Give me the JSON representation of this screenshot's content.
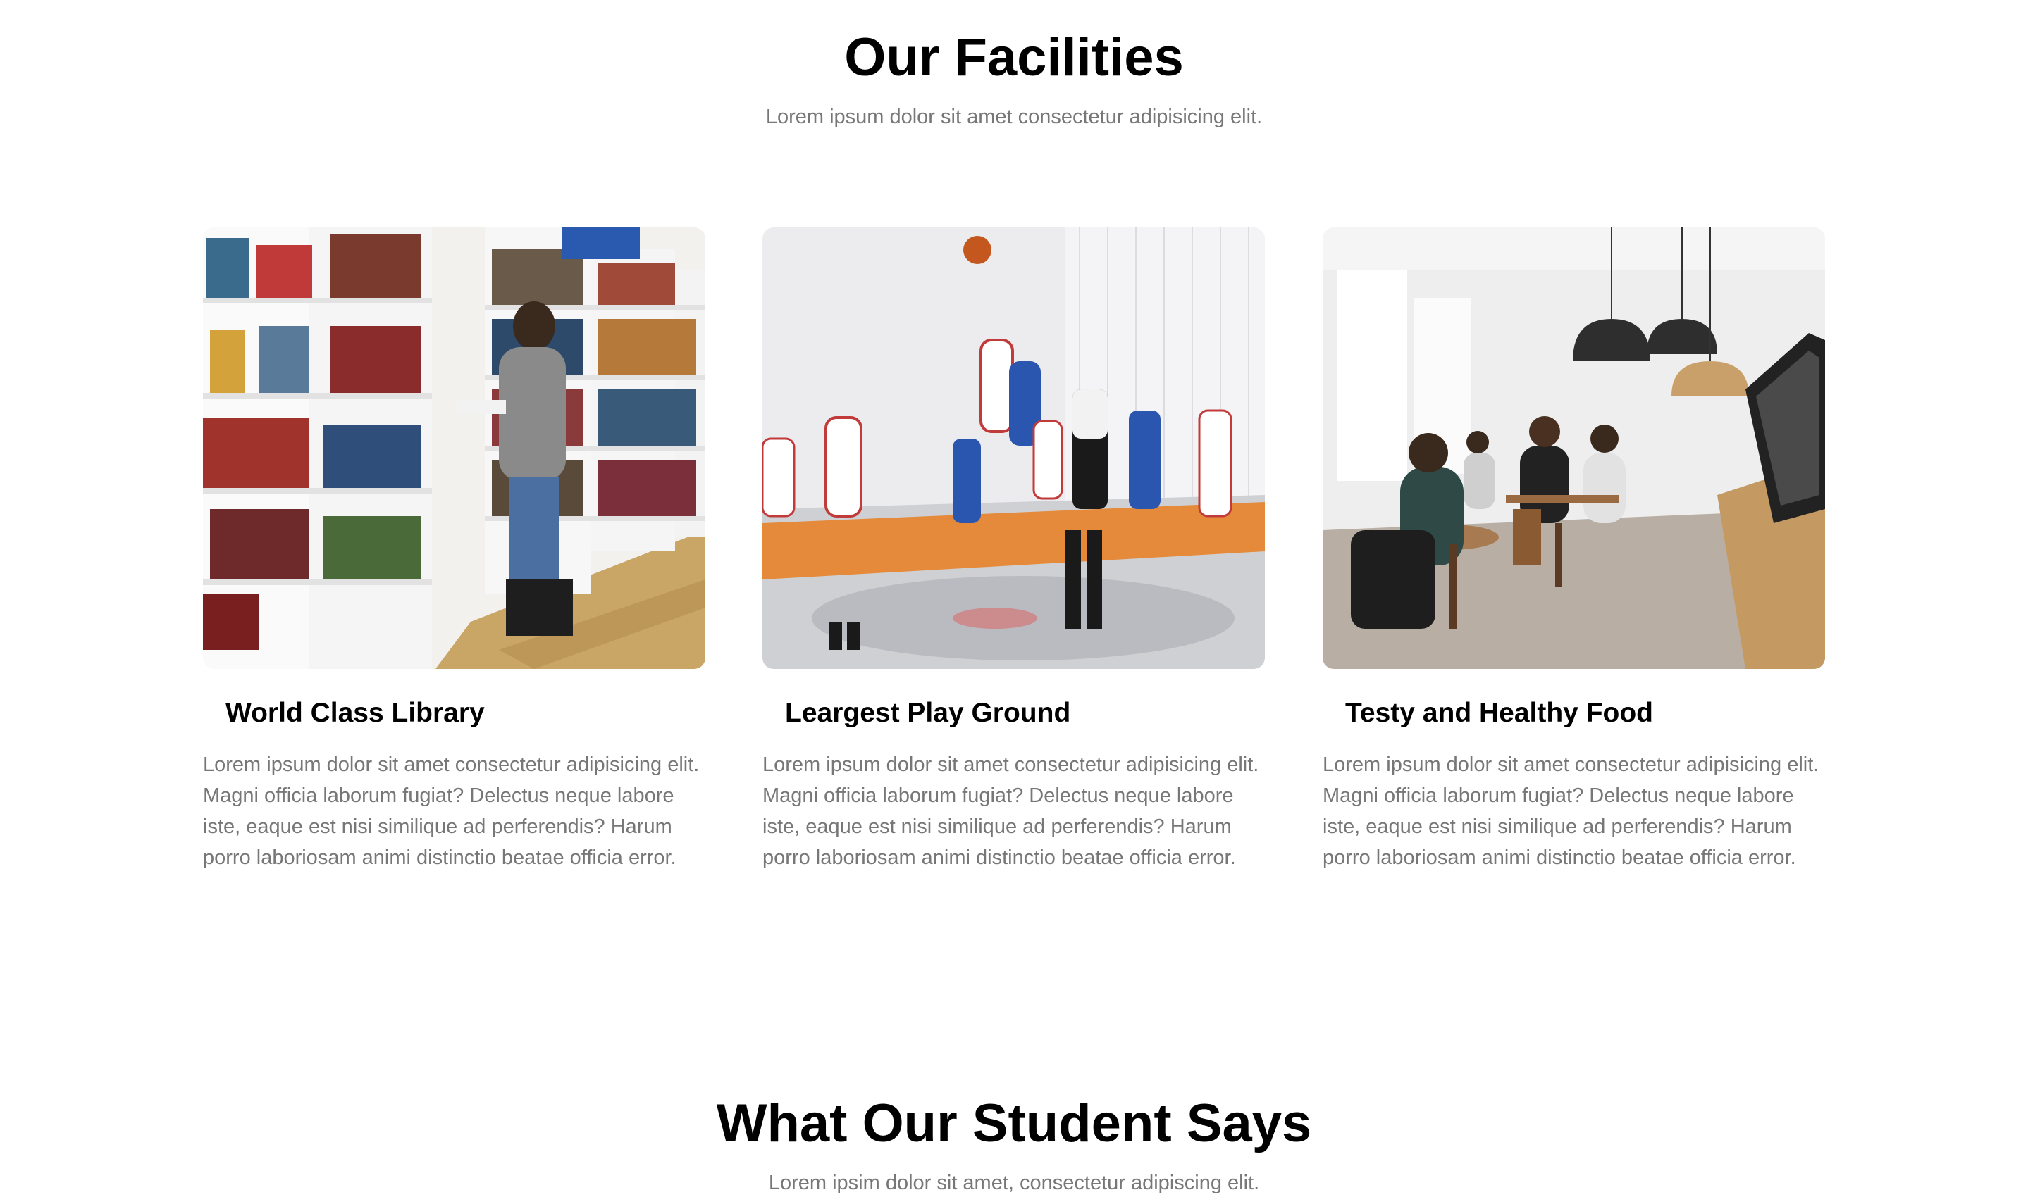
{
  "facilities": {
    "title": "Our Facilities",
    "subtitle": "Lorem ipsum dolor sit amet consectetur adipisicing elit.",
    "cards": [
      {
        "image": "library-photo",
        "title": "World Class Library",
        "text": "Lorem ipsum dolor sit amet consectetur adipisicing elit. Magni officia laborum fugiat? Delectus neque labore iste, eaque est nisi similique ad perferendis? Harum porro laboriosam animi distinctio beatae officia error."
      },
      {
        "image": "basketball-court-photo",
        "title": "Leargest Play Ground",
        "text": "Lorem ipsum dolor sit amet consectetur adipisicing elit. Magni officia laborum fugiat? Delectus neque labore iste, eaque est nisi similique ad perferendis? Harum porro laboriosam animi distinctio beatae officia error."
      },
      {
        "image": "cafeteria-photo",
        "title": "Testy and Healthy Food",
        "text": "Lorem ipsum dolor sit amet consectetur adipisicing elit. Magni officia laborum fugiat? Delectus neque labore iste, eaque est nisi similique ad perferendis? Harum porro laboriosam animi distinctio beatae officia error."
      }
    ]
  },
  "testimonials": {
    "title": "What Our Student Says",
    "subtitle": "Lorem ipsim dolor sit amet, consectetur adipiscing elit."
  }
}
